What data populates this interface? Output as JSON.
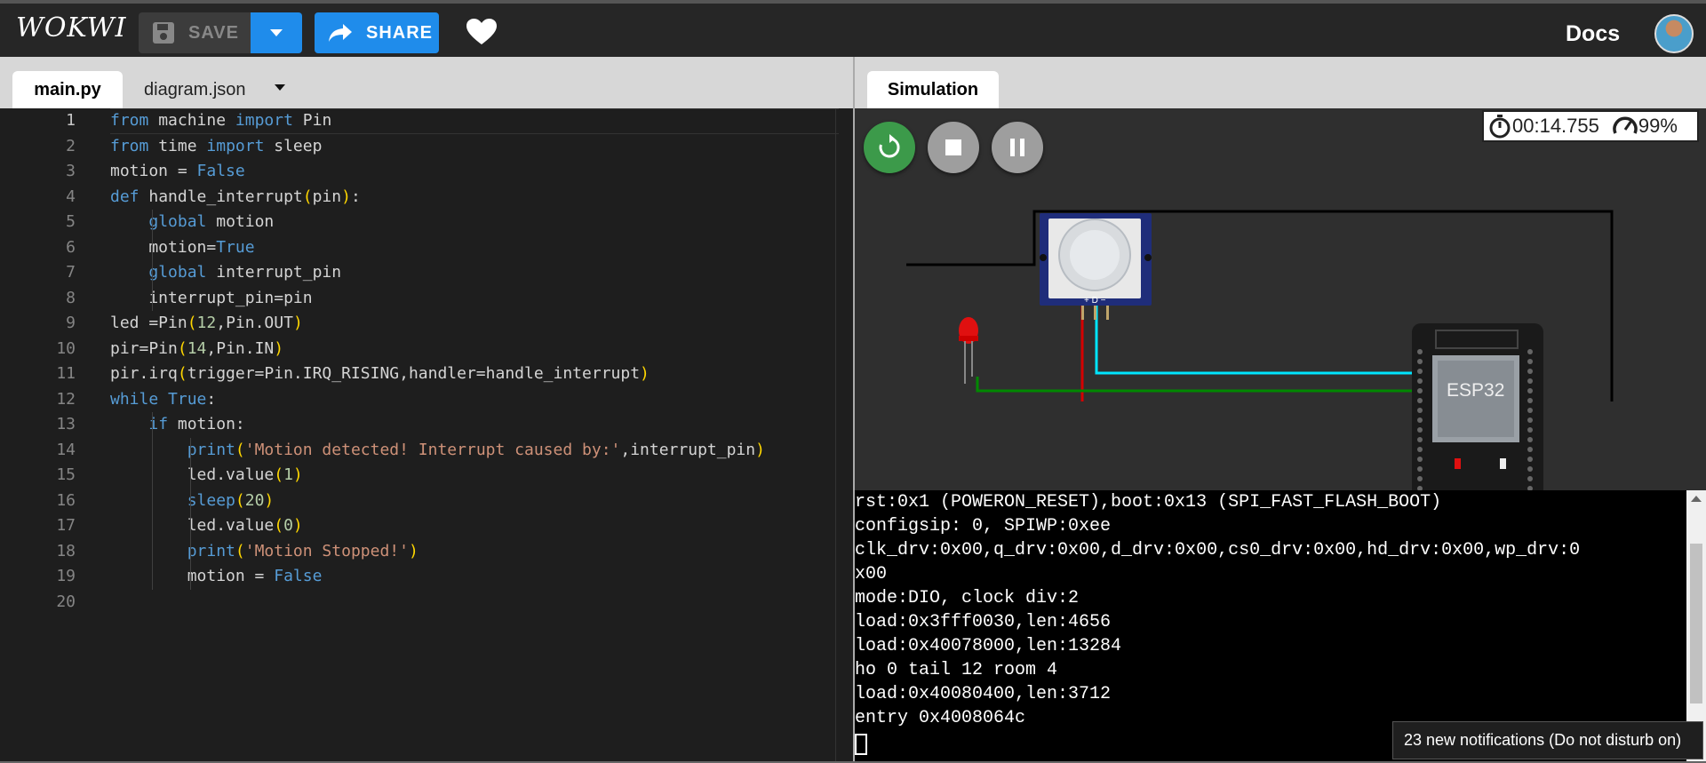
{
  "app": {
    "logo": "WOKWI",
    "save_label": "SAVE",
    "share_label": "SHARE",
    "docs_label": "Docs"
  },
  "editor": {
    "tabs": [
      {
        "label": "main.py",
        "active": true
      },
      {
        "label": "diagram.json",
        "active": false
      }
    ],
    "line_numbers": [
      "1",
      "2",
      "3",
      "4",
      "5",
      "6",
      "7",
      "8",
      "9",
      "10",
      "11",
      "12",
      "13",
      "14",
      "15",
      "16",
      "17",
      "18",
      "19",
      "20"
    ],
    "lines": [
      "from machine import Pin",
      "from time import sleep",
      "motion = False",
      "def handle_interrupt(pin):",
      "    global motion",
      "    motion=True",
      "    global interrupt_pin",
      "    interrupt_pin=pin",
      "led =Pin(12,Pin.OUT)",
      "pir=Pin(14,Pin.IN)",
      "pir.irq(trigger=Pin.IRQ_RISING,handler=handle_interrupt)",
      "while True:",
      "    if motion:",
      "        print('Motion detected! Interrupt caused by:',interrupt_pin)",
      "        led.value(1)",
      "        sleep(20)",
      "        led.value(0)",
      "        print('Motion Stopped!')",
      "        motion = False",
      ""
    ]
  },
  "simulation": {
    "tab_label": "Simulation",
    "timer": "00:14.755",
    "speed": "99%",
    "chip_label": "ESP32",
    "pir_pins": "+ D −"
  },
  "serial": {
    "lines": [
      "rst:0x1 (POWERON_RESET),boot:0x13 (SPI_FAST_FLASH_BOOT)",
      "configsip: 0, SPIWP:0xee",
      "clk_drv:0x00,q_drv:0x00,d_drv:0x00,cs0_drv:0x00,hd_drv:0x00,wp_drv:0",
      "x00",
      "mode:DIO, clock div:2",
      "load:0x3fff0030,len:4656",
      "load:0x40078000,len:13284",
      "ho 0 tail 12 room 4",
      "load:0x40080400,len:3712",
      "entry 0x4008064c"
    ]
  },
  "notification": "23 new notifications (Do not disturb on)",
  "colors": {
    "accent": "#1f8ceb",
    "restart": "#3c9a4a",
    "wire_red": "#d40000",
    "wire_cyan": "#00e5ff",
    "wire_green": "#008800",
    "wire_black": "#000000"
  }
}
